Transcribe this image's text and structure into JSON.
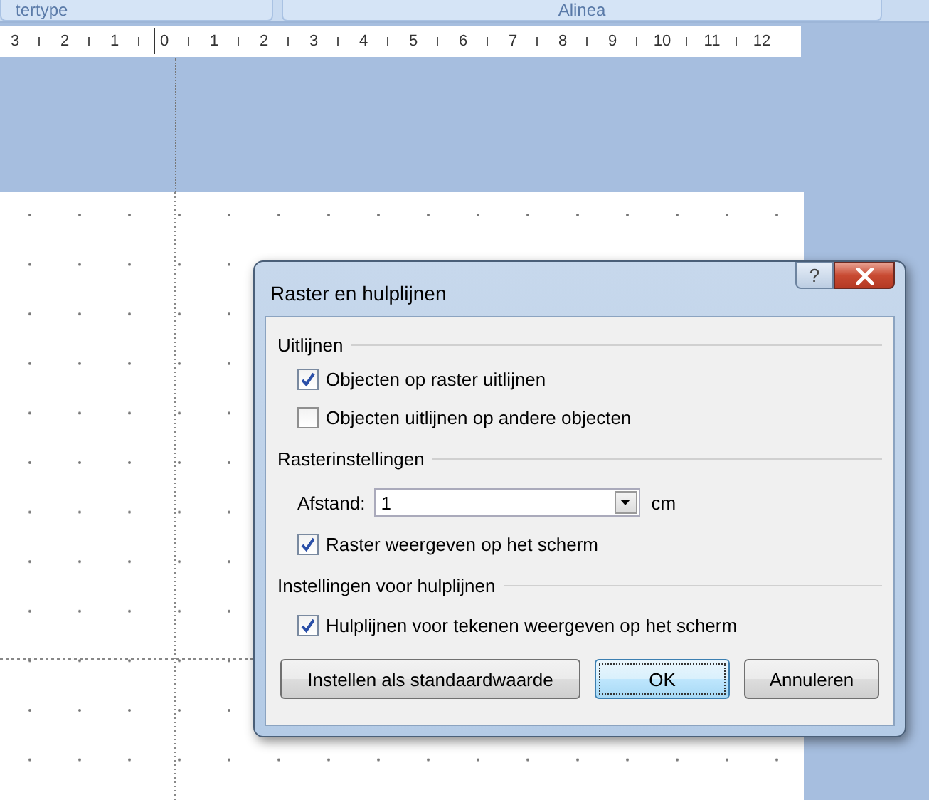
{
  "ribbon": {
    "groups": [
      "tertype",
      "Alinea"
    ]
  },
  "ruler": {
    "numbers": [
      "3",
      "2",
      "1",
      "0",
      "1",
      "2",
      "3",
      "4",
      "5",
      "6",
      "7",
      "8",
      "9",
      "10",
      "11",
      "12"
    ]
  },
  "dialog": {
    "title": "Raster en hulplijnen",
    "help": "?",
    "sections": [
      {
        "title": "Uitlijnen",
        "items": [
          {
            "kind": "checkbox",
            "label": "Objecten op raster uitlijnen",
            "checked": true
          },
          {
            "kind": "checkbox",
            "label": "Objecten uitlijnen op andere objecten",
            "checked": false
          }
        ]
      },
      {
        "title": "Rasterinstellingen",
        "items": [
          {
            "kind": "dropdown",
            "label": "Afstand:",
            "value": "1",
            "unit": "cm"
          },
          {
            "kind": "checkbox",
            "label": "Raster weergeven op het scherm",
            "checked": true
          }
        ]
      },
      {
        "title": "Instellingen voor hulplijnen",
        "items": [
          {
            "kind": "checkbox",
            "label": "Hulplijnen voor tekenen weergeven op het scherm",
            "checked": true
          }
        ]
      }
    ],
    "buttons": [
      {
        "label": "Instellen als standaardwaarde",
        "default": false
      },
      {
        "label": "OK",
        "default": true
      },
      {
        "label": "Annuleren",
        "default": false
      }
    ]
  }
}
